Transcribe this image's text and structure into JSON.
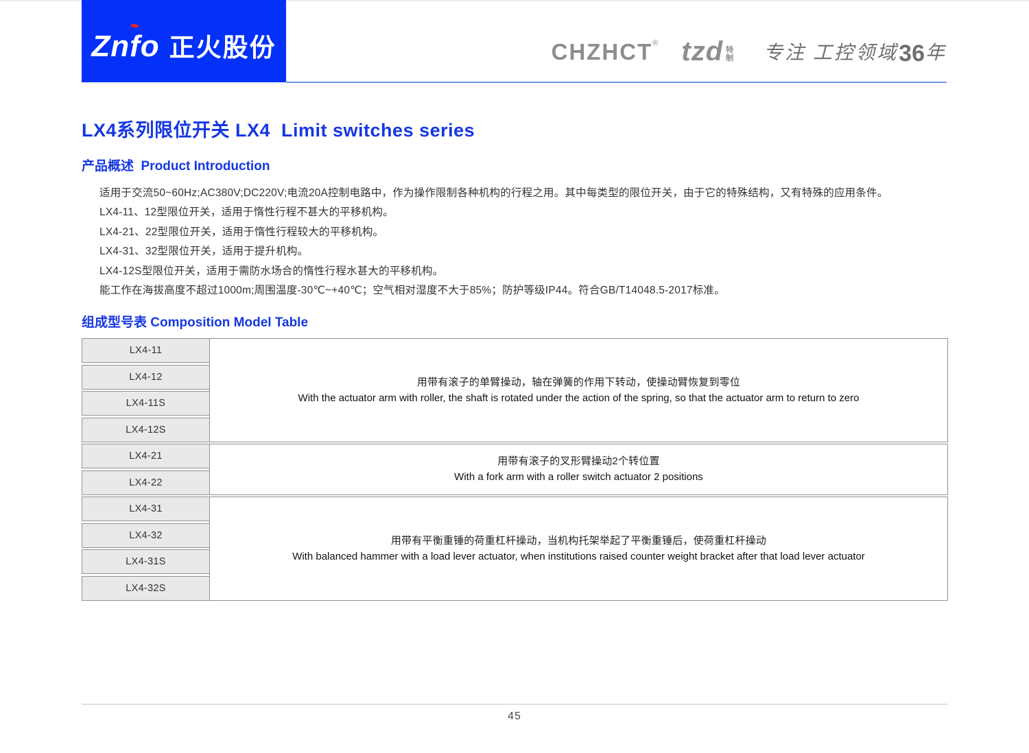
{
  "header": {
    "logo_latin": "Znfo",
    "logo_cn": "正火股份",
    "brand": "CHZHCT",
    "brand_reg": "®",
    "tzd": "tzd",
    "tzd_tag_top": "特",
    "tzd_tag_bottom": "制",
    "slogan_pre": "专注 工控领域",
    "slogan_num": "36",
    "slogan_suf": "年"
  },
  "page": {
    "title": "LX4系列限位开关 LX4  Limit switches series",
    "page_number": "45"
  },
  "sections": {
    "intro_heading": "产品概述  Product Introduction",
    "intro_paragraphs": [
      "适用于交流50~60Hz;AC380V;DC220V;电流20A控制电路中，作为操作限制各种机构的行程之用。其中每类型的限位开关，由于它的特殊结构，又有特殊的应用条件。",
      "LX4-11、12型限位开关，适用于惰性行程不甚大的平移机构。",
      "LX4-21、22型限位开关，适用于惰性行程较大的平移机构。",
      "LX4-31、32型限位开关，适用于提升机构。",
      "LX4-12S型限位开关，适用于需防水场合的惰性行程水甚大的平移机构。",
      "能工作在海拔高度不超过1000m;周围温度-30℃~+40℃；空气相对湿度不大于85%；防护等级IP44。符合GB/T14048.5-2017标准。"
    ],
    "table_heading": "组成型号表 Composition Model Table"
  },
  "model_table": {
    "groups": [
      {
        "models": [
          "LX4-11",
          "LX4-12",
          "LX4-11S",
          "LX4-12S"
        ],
        "desc_cn": "用带有滚子的单臂操动，轴在弹簧的作用下转动，使操动臂恢复到零位",
        "desc_en": "With the actuator arm with roller, the shaft is rotated under the action of the spring, so that the actuator arm to return to zero"
      },
      {
        "models": [
          "LX4-21",
          "LX4-22"
        ],
        "desc_cn": "用带有滚子的叉形臂操动2个转位置",
        "desc_en": "With a fork arm with a roller switch actuator 2 positions"
      },
      {
        "models": [
          "LX4-31",
          "LX4-32",
          "LX4-31S",
          "LX4-32S"
        ],
        "desc_cn": "用带有平衡重锤的荷重杠杆操动，当机构托架举起了平衡重锤后，使荷重杠杆操动",
        "desc_en": "With balanced hammer with a load lever actuator, when institutions raised counter weight bracket after that load lever actuator"
      }
    ]
  },
  "colors": {
    "accent_blue": "#1637e2",
    "logo_blue": "#0431f8",
    "logo_accent_red": "#e8251c",
    "header_line_blue": "#6e9ae4",
    "brand_gray": "#8d8d8d",
    "table_border": "#919191",
    "model_cell_bg": "#e9e9e9",
    "body_text": "#333333"
  }
}
